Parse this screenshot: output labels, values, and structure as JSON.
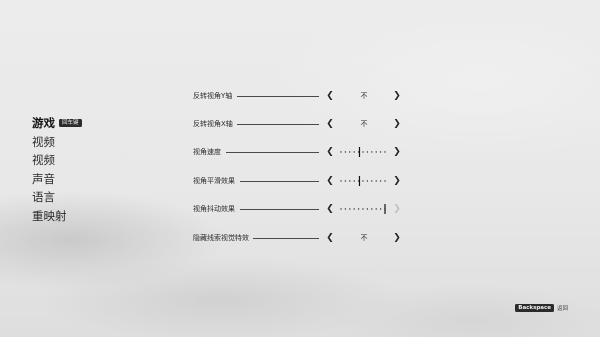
{
  "sidebar": {
    "items": [
      {
        "label": "游戏",
        "badge": "回车键",
        "active": true
      },
      {
        "label": "视频"
      },
      {
        "label": "视频"
      },
      {
        "label": "声音"
      },
      {
        "label": "语言"
      },
      {
        "label": "重映射"
      }
    ]
  },
  "settings": [
    {
      "label": "反转视角Y轴",
      "control": "toggle",
      "value": "不",
      "left_arrow": "❮",
      "right_arrow": "❯"
    },
    {
      "label": "反转视角X轴",
      "control": "toggle",
      "value": "不",
      "left_arrow": "❮",
      "right_arrow": "❯"
    },
    {
      "label": "视角速度",
      "control": "slider",
      "level": 0.42,
      "left_arrow": "❮",
      "right_arrow": "❯"
    },
    {
      "label": "视角平滑效果",
      "control": "slider",
      "level": 0.42,
      "left_arrow": "❮",
      "right_arrow": "❯"
    },
    {
      "label": "视角抖动效果",
      "control": "slider",
      "level": 1.0,
      "right_disabled": true,
      "left_arrow": "❮",
      "right_arrow": "❯"
    },
    {
      "label": "隐藏线索视觉特效",
      "control": "toggle",
      "value": "不",
      "left_arrow": "❮",
      "right_arrow": "❯"
    }
  ],
  "footer": {
    "back_key": "Backspace",
    "back_label": "返回"
  },
  "colors": {
    "text": "#1b1b1b",
    "badge_bg": "#2b2b2b",
    "disabled_arrow": "#c0c0c0"
  }
}
